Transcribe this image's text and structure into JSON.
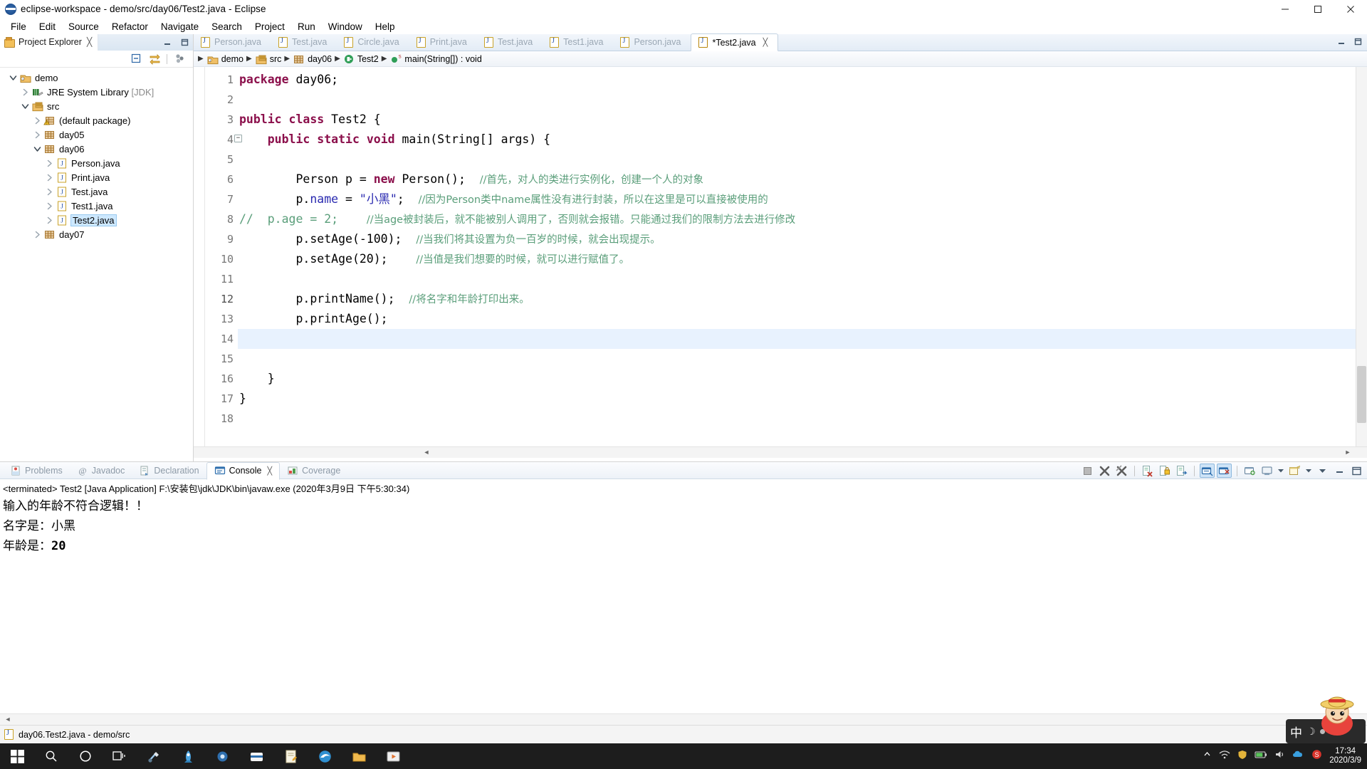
{
  "window": {
    "title": "eclipse-workspace - demo/src/day06/Test2.java - Eclipse",
    "app_icon": "eclipse-icon",
    "minimize": "minimize-button",
    "maximize": "maximize-button",
    "close": "close-button"
  },
  "menubar": {
    "items": [
      {
        "label": "File"
      },
      {
        "label": "Edit"
      },
      {
        "label": "Source"
      },
      {
        "label": "Refactor"
      },
      {
        "label": "Navigate"
      },
      {
        "label": "Search"
      },
      {
        "label": "Project"
      },
      {
        "label": "Run"
      },
      {
        "label": "Window"
      },
      {
        "label": "Help"
      }
    ]
  },
  "explorer": {
    "tab_label": "Project Explorer",
    "close_glyph": "╳",
    "toolbar": [
      {
        "name": "collapse-all-icon"
      },
      {
        "name": "link-with-editor-icon"
      },
      {
        "name": "view-menu-icon"
      }
    ],
    "tree": [
      {
        "label": "demo",
        "indent": 0,
        "twist": "down",
        "icon": "java-project-icon",
        "selected": false
      },
      {
        "label": "JRE System Library",
        "suffix": " [JDK]",
        "indent": 1,
        "twist": "right",
        "icon": "library-icon",
        "selected": false
      },
      {
        "label": "src",
        "indent": 1,
        "twist": "down",
        "icon": "source-folder-icon",
        "selected": false
      },
      {
        "label": "(default package)",
        "indent": 2,
        "twist": "right",
        "icon": "package-warn-icon",
        "selected": false
      },
      {
        "label": "day05",
        "indent": 2,
        "twist": "right",
        "icon": "package-icon",
        "selected": false
      },
      {
        "label": "day06",
        "indent": 2,
        "twist": "down",
        "icon": "package-icon",
        "selected": false
      },
      {
        "label": "Person.java",
        "indent": 3,
        "twist": "right",
        "icon": "java-file-icon",
        "selected": false
      },
      {
        "label": "Print.java",
        "indent": 3,
        "twist": "right",
        "icon": "java-file-icon",
        "selected": false
      },
      {
        "label": "Test.java",
        "indent": 3,
        "twist": "right",
        "icon": "java-file-icon",
        "selected": false
      },
      {
        "label": "Test1.java",
        "indent": 3,
        "twist": "right",
        "icon": "java-file-icon",
        "selected": false
      },
      {
        "label": "Test2.java",
        "indent": 3,
        "twist": "right",
        "icon": "java-file-icon",
        "selected": true
      },
      {
        "label": "day07",
        "indent": 2,
        "twist": "right",
        "icon": "package-icon",
        "selected": false
      }
    ]
  },
  "editor": {
    "tabs": [
      {
        "label": "Person.java",
        "active": false
      },
      {
        "label": "Test.java",
        "active": false
      },
      {
        "label": "Circle.java",
        "active": false
      },
      {
        "label": "Print.java",
        "active": false
      },
      {
        "label": "Test.java",
        "active": false
      },
      {
        "label": "Test1.java",
        "active": false
      },
      {
        "label": "Person.java",
        "active": false
      },
      {
        "label": "*Test2.java",
        "active": true,
        "close_glyph": "╳"
      }
    ],
    "breadcrumb": [
      {
        "label": "demo",
        "icon": "java-project-icon"
      },
      {
        "label": "src",
        "icon": "source-folder-icon"
      },
      {
        "label": "day06",
        "icon": "package-icon"
      },
      {
        "label": "Test2",
        "icon": "class-icon"
      },
      {
        "label": "main(String[]) : void",
        "icon": "method-public-static-icon"
      }
    ],
    "line_numbers": [
      "1",
      "2",
      "3",
      "4",
      "5",
      "6",
      "7",
      "8",
      "9",
      "10",
      "11",
      "12",
      "13",
      "14",
      "15",
      "16",
      "17",
      "18"
    ],
    "current_line": 12,
    "highlighted_line": 14,
    "fold_line": 4,
    "code": [
      {
        "n": 1,
        "tokens": [
          {
            "t": "package ",
            "c": "kw"
          },
          {
            "t": "day06;",
            "c": ""
          }
        ]
      },
      {
        "n": 2,
        "tokens": []
      },
      {
        "n": 3,
        "tokens": [
          {
            "t": "public class ",
            "c": "kw"
          },
          {
            "t": "Test2 {",
            "c": ""
          }
        ]
      },
      {
        "n": 4,
        "tokens": [
          {
            "t": "    ",
            "c": ""
          },
          {
            "t": "public static void ",
            "c": "kw"
          },
          {
            "t": "main(String[] args) {",
            "c": ""
          }
        ]
      },
      {
        "n": 5,
        "tokens": []
      },
      {
        "n": 6,
        "tokens": [
          {
            "t": "        Person p = ",
            "c": ""
          },
          {
            "t": "new ",
            "c": "kw"
          },
          {
            "t": "Person();  ",
            "c": ""
          },
          {
            "t": "//首先，对人的类进行实例化，创建一个人的对象",
            "c": "cmt-cn"
          }
        ]
      },
      {
        "n": 7,
        "tokens": [
          {
            "t": "        p.",
            "c": ""
          },
          {
            "t": "name",
            "c": "str"
          },
          {
            "t": " = ",
            "c": ""
          },
          {
            "t": "\"小黑\"",
            "c": "str"
          },
          {
            "t": ";  ",
            "c": ""
          },
          {
            "t": "//因为Person类中name属性没有进行封装，所以在这里是可以直接被使用的",
            "c": "cmt-cn"
          }
        ]
      },
      {
        "n": 8,
        "tokens": [
          {
            "t": "//  p.age = 2;    ",
            "c": "cmt"
          },
          {
            "t": "//当age被封装后，就不能被别人调用了，否则就会报错。只能通过我们的限制方法去进行修改",
            "c": "cmt-cn"
          }
        ]
      },
      {
        "n": 9,
        "tokens": [
          {
            "t": "        p.setAge(-100);  ",
            "c": ""
          },
          {
            "t": "//当我们将其设置为负一百岁的时候，就会出现提示。",
            "c": "cmt-cn"
          }
        ]
      },
      {
        "n": 10,
        "tokens": [
          {
            "t": "        p.setAge(20);    ",
            "c": ""
          },
          {
            "t": "//当值是我们想要的时候，就可以进行赋值了。",
            "c": "cmt-cn"
          }
        ]
      },
      {
        "n": 11,
        "tokens": []
      },
      {
        "n": 12,
        "tokens": [
          {
            "t": "        p.printName();  ",
            "c": ""
          },
          {
            "t": "//将名字和年龄打印出来。",
            "c": "cmt-cn"
          }
        ]
      },
      {
        "n": 13,
        "tokens": [
          {
            "t": "        p.printAge();",
            "c": ""
          }
        ]
      },
      {
        "n": 14,
        "tokens": []
      },
      {
        "n": 15,
        "tokens": []
      },
      {
        "n": 16,
        "tokens": [
          {
            "t": "    }",
            "c": ""
          }
        ]
      },
      {
        "n": 17,
        "tokens": [
          {
            "t": "}",
            "c": ""
          }
        ]
      },
      {
        "n": 18,
        "tokens": []
      }
    ]
  },
  "console_panel": {
    "tabs": [
      {
        "label": "Problems",
        "icon": "problems-icon",
        "active": false
      },
      {
        "label": "Javadoc",
        "icon": "javadoc-icon",
        "active": false
      },
      {
        "label": "Declaration",
        "icon": "declaration-icon",
        "active": false
      },
      {
        "label": "Console",
        "icon": "console-icon",
        "active": true,
        "close_glyph": "╳"
      },
      {
        "label": "Coverage",
        "icon": "coverage-icon",
        "active": false
      }
    ],
    "toolbar": [
      {
        "name": "terminate-icon"
      },
      {
        "name": "remove-launch-icon"
      },
      {
        "name": "remove-all-launches-icon"
      },
      {
        "name": "clear-console-icon"
      },
      {
        "name": "scroll-lock-icon"
      },
      {
        "name": "show-console-on-output-icon"
      },
      {
        "name": "pin-console-icon"
      },
      {
        "name": "display-selected-console-icon"
      },
      {
        "name": "open-console-icon"
      },
      {
        "name": "console-dropdown-icon"
      },
      {
        "name": "new-console-view-icon"
      },
      {
        "name": "view-menu-icon"
      },
      {
        "name": "minimize-panel-icon"
      },
      {
        "name": "maximize-panel-icon"
      }
    ],
    "launch_header": "<terminated> Test2 [Java Application] F:\\安装包\\jdk\\JDK\\bin\\javaw.exe (2020年3月9日 下午5:30:34)",
    "output": [
      {
        "text": "输入的年龄不符合逻辑！！",
        "mono": false
      },
      {
        "text": "名字是：小黑",
        "mono": false
      },
      {
        "text": "年龄是：",
        "mono": false,
        "value": "20"
      }
    ]
  },
  "statusbar": {
    "icon": "java-file-icon",
    "text": "day06.Test2.java - demo/src",
    "right_icons": [
      {
        "name": "smart-insert-icon"
      },
      {
        "name": "writable-indicator"
      }
    ]
  },
  "taskbar": {
    "items": [
      {
        "name": "start-button"
      },
      {
        "name": "search-icon"
      },
      {
        "name": "cortana-icon"
      },
      {
        "name": "task-view-icon"
      },
      {
        "name": "app-icon-explorer-tools"
      },
      {
        "name": "app-icon-rocket"
      },
      {
        "name": "app-icon-settings"
      },
      {
        "name": "app-icon-browser"
      },
      {
        "name": "app-icon-notes"
      },
      {
        "name": "app-icon-edge"
      },
      {
        "name": "app-icon-folder"
      },
      {
        "name": "app-icon-media"
      }
    ],
    "tray": [
      {
        "name": "show-hidden-icons"
      },
      {
        "name": "network-icon"
      },
      {
        "name": "shield-icon"
      },
      {
        "name": "battery-icon"
      },
      {
        "name": "volume-icon"
      },
      {
        "name": "onedrive-icon"
      },
      {
        "name": "security-icon"
      }
    ],
    "clock_time": "17:34",
    "clock_date": "2020/3/9"
  },
  "ime": {
    "mode_label": "中",
    "moon_glyph": "☽",
    "avatar": "luffy-avatar"
  }
}
